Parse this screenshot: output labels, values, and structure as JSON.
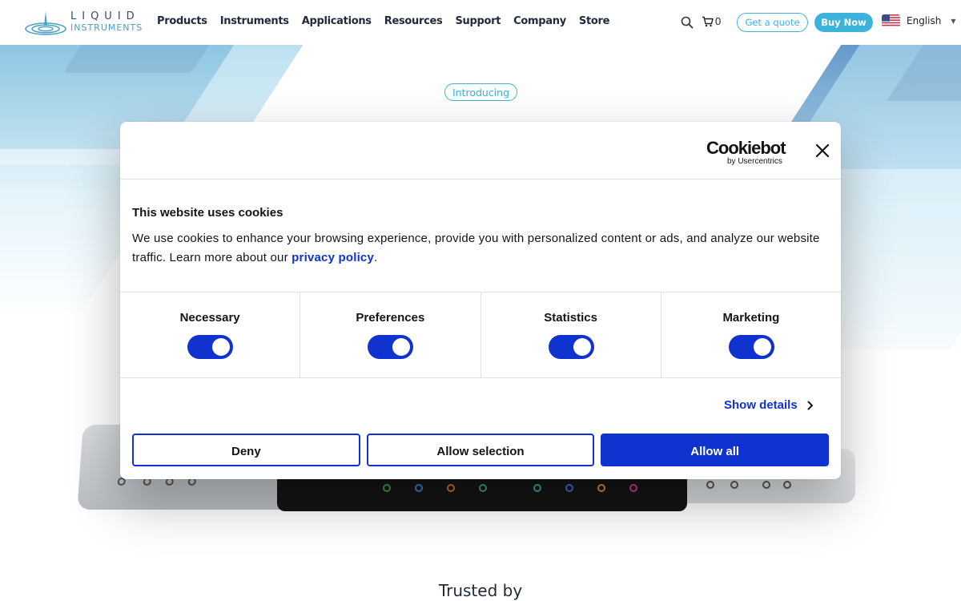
{
  "header": {
    "logo_line1": "LIQUID",
    "logo_line2": "INSTRUMENTS",
    "nav": [
      "Products",
      "Instruments",
      "Applications",
      "Resources",
      "Support",
      "Company",
      "Store"
    ],
    "cart_count": "0",
    "quote_label": "Get a quote",
    "buy_label": "Buy Now",
    "language": "English"
  },
  "hero": {
    "badge": "Introducing",
    "trusted": "Trusted by",
    "accent_color": "#3db3dc"
  },
  "cookie_dialog": {
    "brand": "Cookiebot",
    "brand_sub": "by Usercentrics",
    "title": "This website uses cookies",
    "text": "We use cookies to enhance your browsing experience, provide you with personalized content or ads, and analyze our website traffic. Learn more about our ",
    "link_text": "privacy policy",
    "text_end": ".",
    "toggles": [
      {
        "label": "Necessary",
        "on": true
      },
      {
        "label": "Preferences",
        "on": true
      },
      {
        "label": "Statistics",
        "on": true
      },
      {
        "label": "Marketing",
        "on": true
      }
    ],
    "show_details": "Show details",
    "deny_label": "Deny",
    "allow_selection_label": "Allow selection",
    "allow_all_label": "Allow all",
    "accent_color": "#1032cf"
  }
}
